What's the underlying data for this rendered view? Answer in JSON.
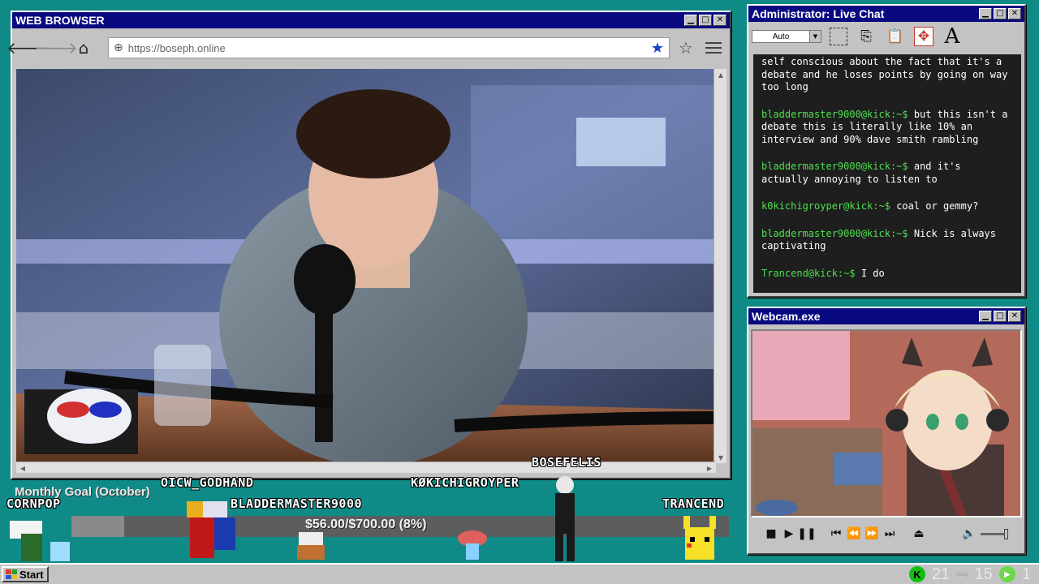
{
  "browser": {
    "title": "WEB BROWSER",
    "url": "https://boseph.online",
    "icons": {
      "back": "back-arrow-icon",
      "forward": "forward-arrow-icon",
      "home": "home-icon",
      "globe": "globe-icon",
      "bookmark": "bookmark-star-icon",
      "favorite": "favorite-star-icon",
      "menu": "hamburger-menu-icon"
    },
    "controls": {
      "minimize": "▁",
      "maximize": "□",
      "close": "✕"
    }
  },
  "chat": {
    "title": "Administrator: Live Chat",
    "font_size": "Auto",
    "user_color": "#4ee04e",
    "messages": [
      {
        "user": "",
        "text": "self conscious about the fact that it's a debate and he loses points by going on way too long"
      },
      {
        "user": "bladdermaster9000@kick:~$",
        "text": "but this isn't a debate this is literally like 10% an interview and 90% dave smith rambling"
      },
      {
        "user": "bladdermaster9000@kick:~$",
        "text": "and it's actually annoying to listen to"
      },
      {
        "user": "k0kichigroyper@kick:~$",
        "text": "coal or gemmy?"
      },
      {
        "user": "bladdermaster9000@kick:~$",
        "text": "Nick is always captivating"
      },
      {
        "user": "Trancend@kick:~$",
        "text": "I do"
      }
    ]
  },
  "webcam": {
    "title": "Webcam.exe"
  },
  "overlay": {
    "goal_title": "Monthly Goal (October)",
    "goal_text": "$56.00/$700.00 (8%)",
    "goal_progress": 0.08,
    "names": {
      "cornpop": "CORNPOP",
      "godhand": "OICW_GODHAND",
      "bladder": "BLADDERMASTER9000",
      "kokichi": "KØKICHIGROYPER",
      "bosefelis": "BOSEFELIS",
      "trancend": "TRANCEND"
    }
  },
  "taskbar": {
    "start_label": "Start",
    "tray_kick": "K",
    "tray_count_a": "21",
    "tray_cozy": "cozy",
    "tray_count_b": "15",
    "tray_count_c": "1"
  }
}
